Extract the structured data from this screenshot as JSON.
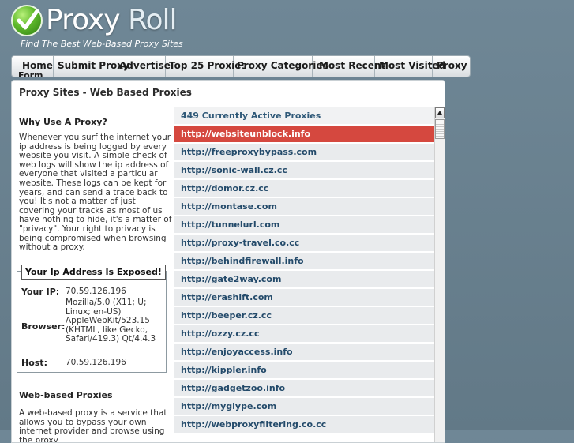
{
  "header": {
    "logo_text_1": "Proxy",
    "logo_text_2": " Roll",
    "tagline": "Find The Best Web-Based Proxy Sites"
  },
  "nav": {
    "items": [
      "Home",
      "Submit Proxy",
      "Advertise",
      "Top 25 Proxies",
      "Proxy Categories",
      "Most Recent",
      "Most Visited",
      "Proxy"
    ],
    "tail": "Form"
  },
  "panel": {
    "title": "Proxy Sites - Web Based Proxies"
  },
  "why": {
    "heading": "Why Use A Proxy?",
    "text": "Whenever you surf the internet your ip address is being logged by every website you visit. A simple check of web logs will show the ip address of everyone that visited a particular website. These logs can be kept for years, and can send a trace back to you! It's not a matter of just covering your tracks as most of us have nothing to hide, it's a matter of \"privacy\". Your right to privacy is being compromised when browsing without a proxy."
  },
  "ip_box": {
    "legend": "Your Ip Address Is Exposed!",
    "ip_label": "Your IP:",
    "ip_value": "70.59.126.196",
    "browser_label": "Browser:",
    "browser_value": "Mozilla/5.0 (X11; U; Linux; en-US) AppleWebKit/523.15 (KHTML, like Gecko, Safari/419.3) Qt/4.4.3",
    "host_label": "Host:",
    "host_value": "70.59.126.196"
  },
  "web": {
    "heading": "Web-based Proxies",
    "text": "A web-based proxy is a service that allows you to bypass your own internet provider and browse using the proxy"
  },
  "list": {
    "header": "449 Currently Active Proxies",
    "proxies": [
      "http://websiteunblock.info",
      "http://freeproxybypass.com",
      "http://sonic-wall.cz.cc",
      "http://domor.cz.cc",
      "http://montase.com",
      "http://tunnelurl.com",
      "http://proxy-travel.co.cc",
      "http://behindfirewall.info",
      "http://gate2way.com",
      "http://erashift.com",
      "http://beeper.cz.cc",
      "http://ozzy.cz.cc",
      "http://enjoyaccess.info",
      "http://kippler.info",
      "http://gadgetzoo.info",
      "http://myglype.com",
      "http://webproxyfiltering.co.cc"
    ]
  },
  "colors": {
    "background": "#6b8290",
    "active_row": "#d5483f",
    "link": "#234a6a",
    "logo_green": "#5db82a"
  }
}
